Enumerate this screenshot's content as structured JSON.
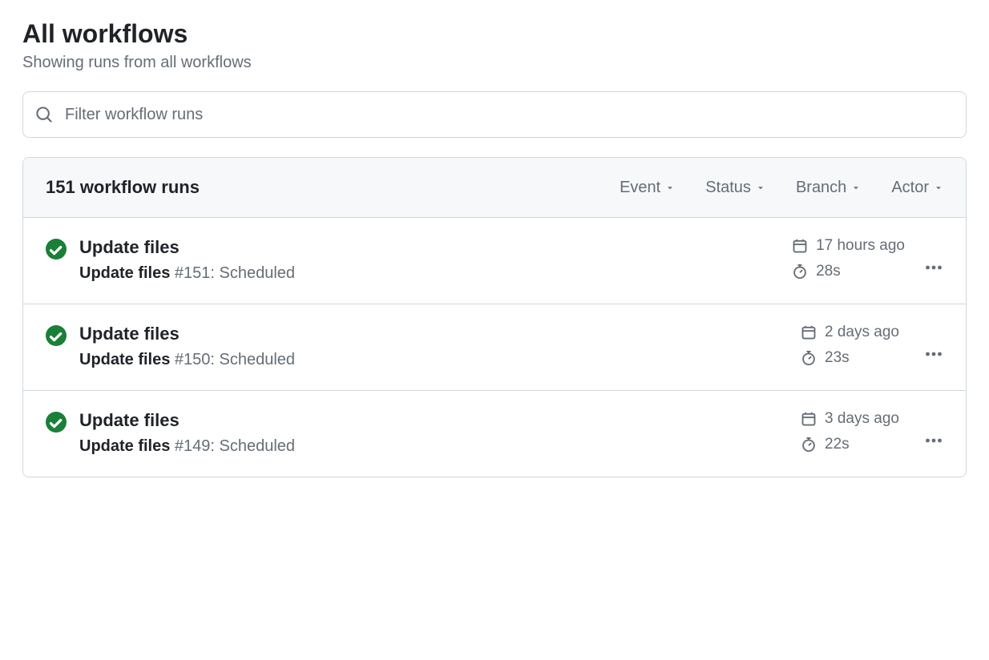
{
  "header": {
    "title": "All workflows",
    "subtitle": "Showing runs from all workflows"
  },
  "search": {
    "placeholder": "Filter workflow runs"
  },
  "runs_header": {
    "count_label": "151 workflow runs",
    "filters": {
      "event": "Event",
      "status": "Status",
      "branch": "Branch",
      "actor": "Actor"
    }
  },
  "runs": [
    {
      "title": "Update files",
      "workflow_name": "Update files",
      "run_number": "#151",
      "trigger": "Scheduled",
      "time_ago": "17 hours ago",
      "duration": "28s"
    },
    {
      "title": "Update files",
      "workflow_name": "Update files",
      "run_number": "#150",
      "trigger": "Scheduled",
      "time_ago": "2 days ago",
      "duration": "23s"
    },
    {
      "title": "Update files",
      "workflow_name": "Update files",
      "run_number": "#149",
      "trigger": "Scheduled",
      "time_ago": "3 days ago",
      "duration": "22s"
    }
  ]
}
